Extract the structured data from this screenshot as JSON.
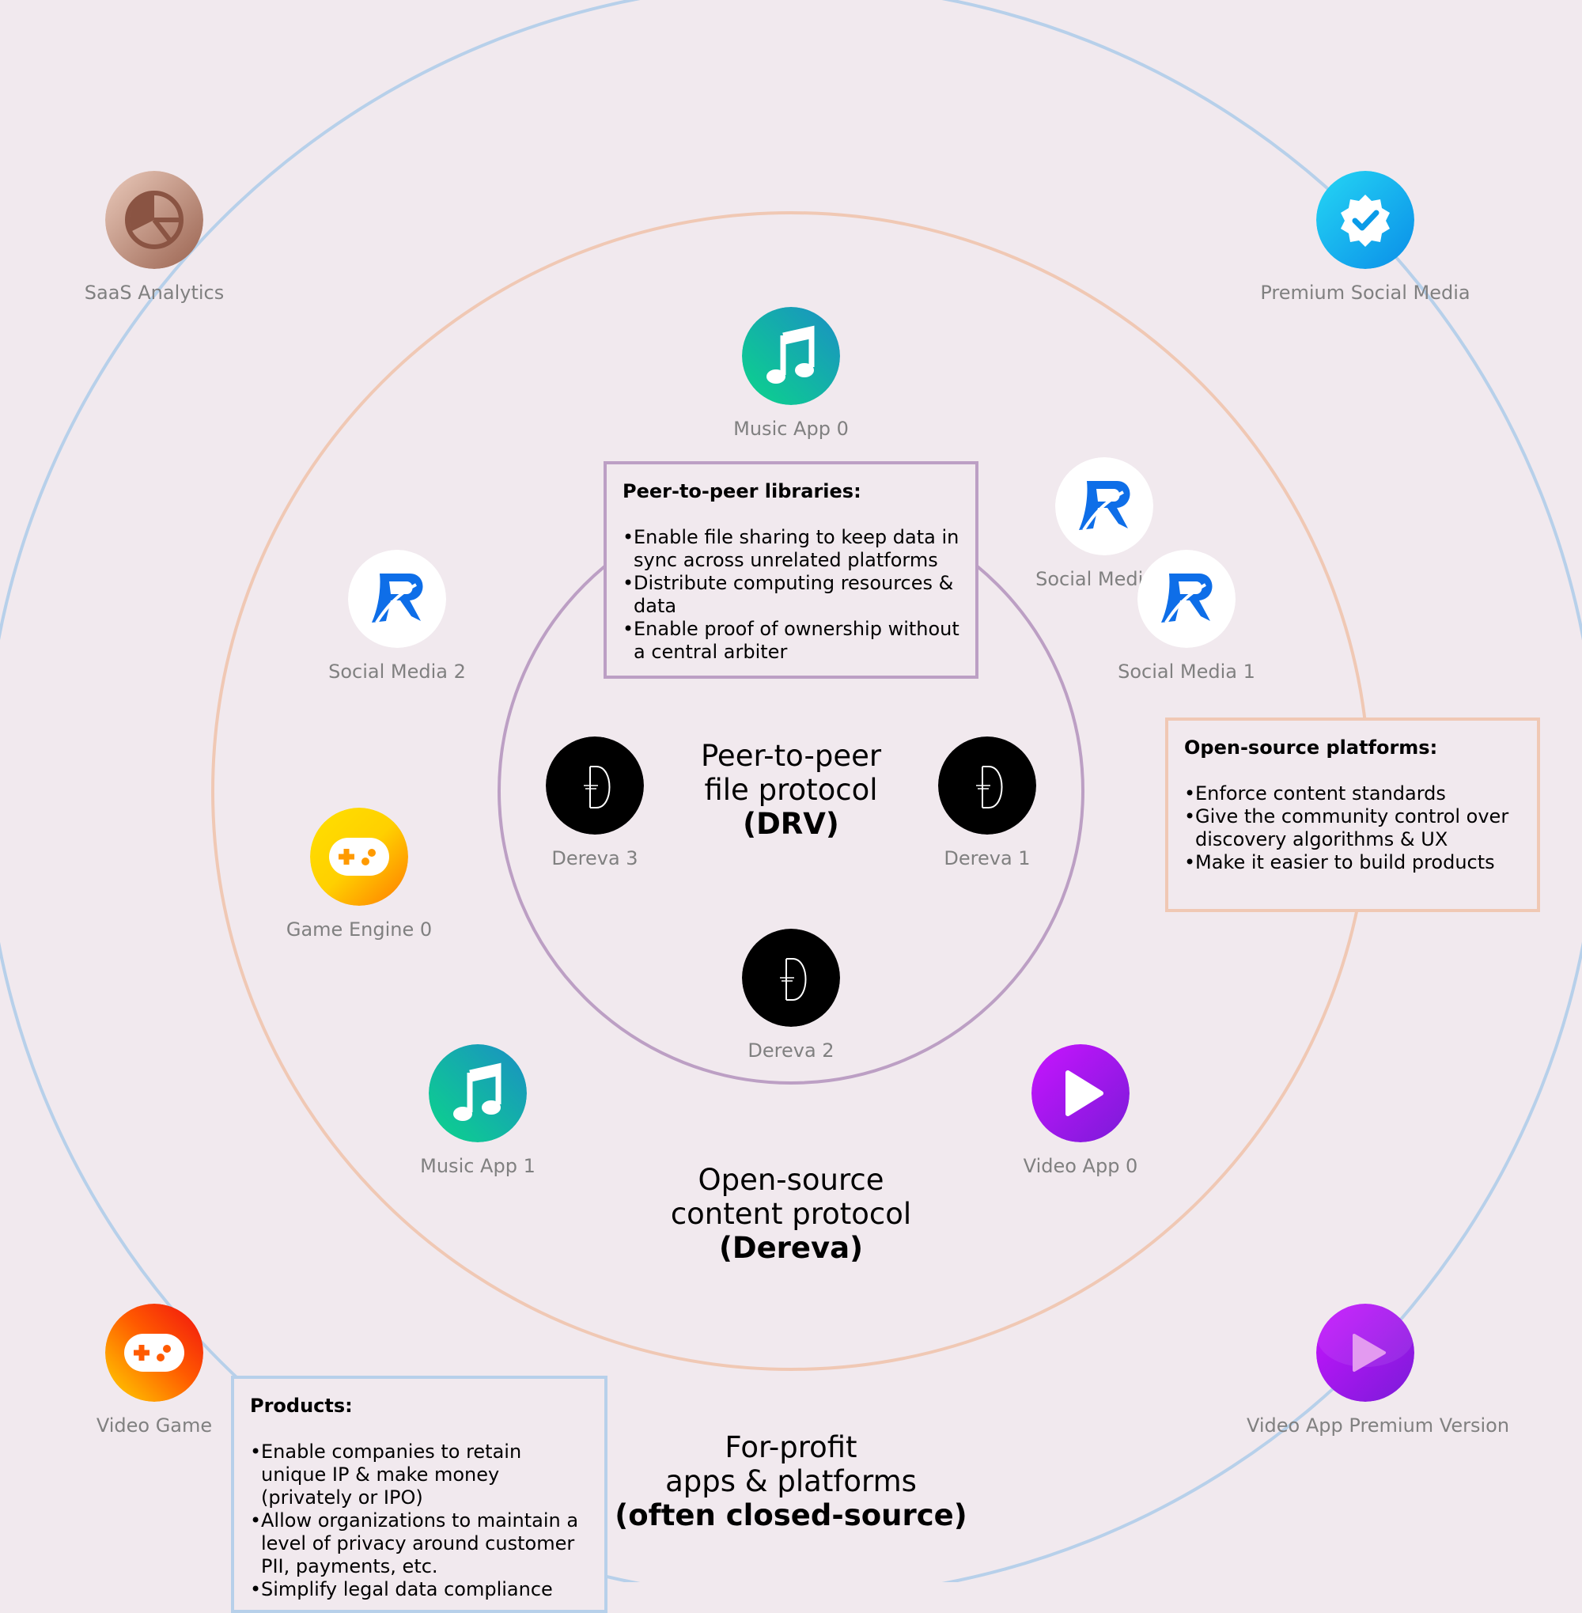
{
  "colors": {
    "background": "#f1e9ee",
    "ring_drv": "#bc9fc4",
    "ring_dereva": "#f0c8b4",
    "ring_forprofit": "#b7d0ea",
    "label_gray": "#808080"
  },
  "center_labels": {
    "drv": {
      "line1": "Peer-to-peer",
      "line2": "file protocol",
      "line3": "(DRV)"
    },
    "dereva": {
      "line1": "Open-source",
      "line2": "content protocol",
      "line3": "(Dereva)"
    },
    "forprofit": {
      "line1": "For-profit",
      "line2": "apps & platforms",
      "line3": "(often closed-source)"
    }
  },
  "nodes": {
    "saas_analytics": {
      "label": "SaaS Analytics",
      "icon": "pie-chart-icon"
    },
    "premium_social_media": {
      "label": "Premium Social Media",
      "icon": "verified-badge-icon"
    },
    "music_app_0": {
      "label": "Music App 0",
      "icon": "music-note-icon"
    },
    "social_media_0": {
      "label": "Social Media 0",
      "icon": "quill-r-logo-icon"
    },
    "social_media_1": {
      "label": "Social Media 1",
      "icon": "quill-r-logo-icon"
    },
    "social_media_2": {
      "label": "Social Media 2",
      "icon": "quill-r-logo-icon"
    },
    "game_engine_0": {
      "label": "Game Engine 0",
      "icon": "gamepad-icon"
    },
    "dereva_1": {
      "label": "Dereva 1",
      "icon": "dereva-logo-icon"
    },
    "dereva_2": {
      "label": "Dereva 2",
      "icon": "dereva-logo-icon"
    },
    "dereva_3": {
      "label": "Dereva 3",
      "icon": "dereva-logo-icon"
    },
    "music_app_1": {
      "label": "Music App 1",
      "icon": "music-note-icon"
    },
    "video_app_0": {
      "label": "Video App 0",
      "icon": "play-icon"
    },
    "video_game": {
      "label": "Video Game",
      "icon": "gamepad-icon"
    },
    "video_app_premium": {
      "label": "Video App Premium Version",
      "icon": "play-icon"
    }
  },
  "boxes": {
    "p2p": {
      "title": "Peer-to-peer libraries:",
      "items": [
        "Enable file sharing to keep data in sync across unrelated platforms",
        "Distribute computing resources & data",
        "Enable proof of ownership without a central arbiter"
      ]
    },
    "open_source": {
      "title": "Open-source platforms:",
      "items": [
        "Enforce content standards",
        "Give the community control over discovery algorithms & UX",
        "Make it easier to build products"
      ]
    },
    "products": {
      "title": "Products:",
      "items": [
        "Enable companies to retain unique IP & make money (privately or IPO)",
        "Allow organizations to maintain a level of privacy around customer PII, payments, etc.",
        "Simplify legal data compliance"
      ]
    }
  }
}
